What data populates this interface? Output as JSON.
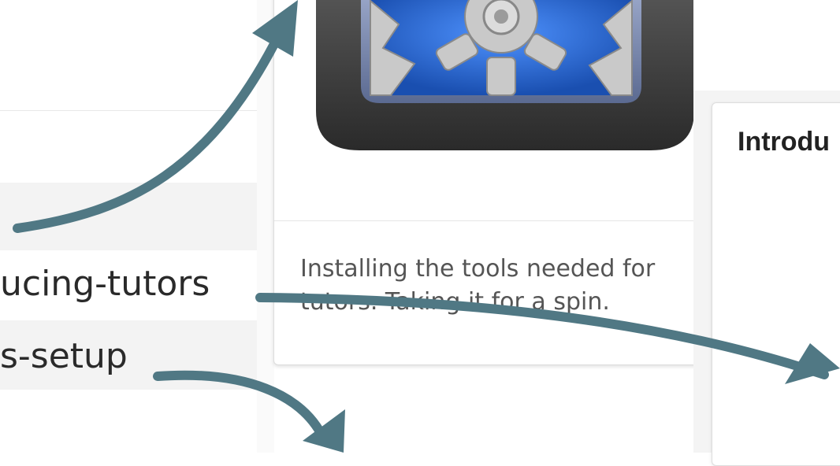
{
  "sidebar": {
    "items": [
      {
        "label": ""
      },
      {
        "label": "ucing-tutors"
      },
      {
        "label": "s-setup"
      }
    ]
  },
  "cards": {
    "setup": {
      "description": "Installing the tools needed for tutors. Taking it for a spin."
    },
    "intro": {
      "title": "Introdu"
    }
  },
  "colors": {
    "arrow": "#507884",
    "icon_frame": "#3d3d3d",
    "gear_blue": "#2f6fd6"
  },
  "icons": [
    "gear-app-icon"
  ]
}
